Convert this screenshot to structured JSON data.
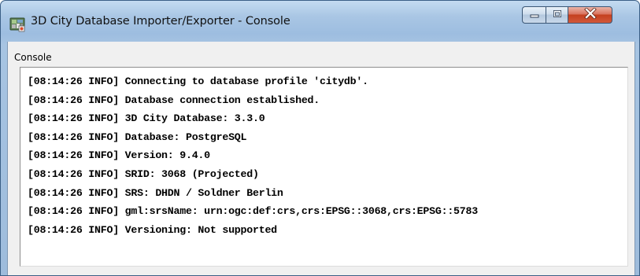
{
  "window": {
    "title": "3D City Database Importer/Exporter - Console",
    "icon": "app-globe-icon"
  },
  "caption_buttons": {
    "minimize_icon": "minimize-icon",
    "maximize_icon": "maximize-icon",
    "close_icon": "close-icon",
    "close_color": "#c4401f"
  },
  "panel": {
    "label": "Console"
  },
  "console": {
    "lines": [
      "[08:14:26 INFO] Connecting to database profile 'citydb'.",
      "[08:14:26 INFO] Database connection established.",
      "[08:14:26 INFO] 3D City Database: 3.3.0",
      "[08:14:26 INFO] Database: PostgreSQL",
      "[08:14:26 INFO] Version: 9.4.0",
      "[08:14:26 INFO] SRID: 3068 (Projected)",
      "[08:14:26 INFO] SRS: DHDN / Soldner Berlin",
      "[08:14:26 INFO] gml:srsName: urn:ogc:def:crs,crs:EPSG::3068,crs:EPSG::5783",
      "[08:14:26 INFO] Versioning: Not supported"
    ]
  }
}
